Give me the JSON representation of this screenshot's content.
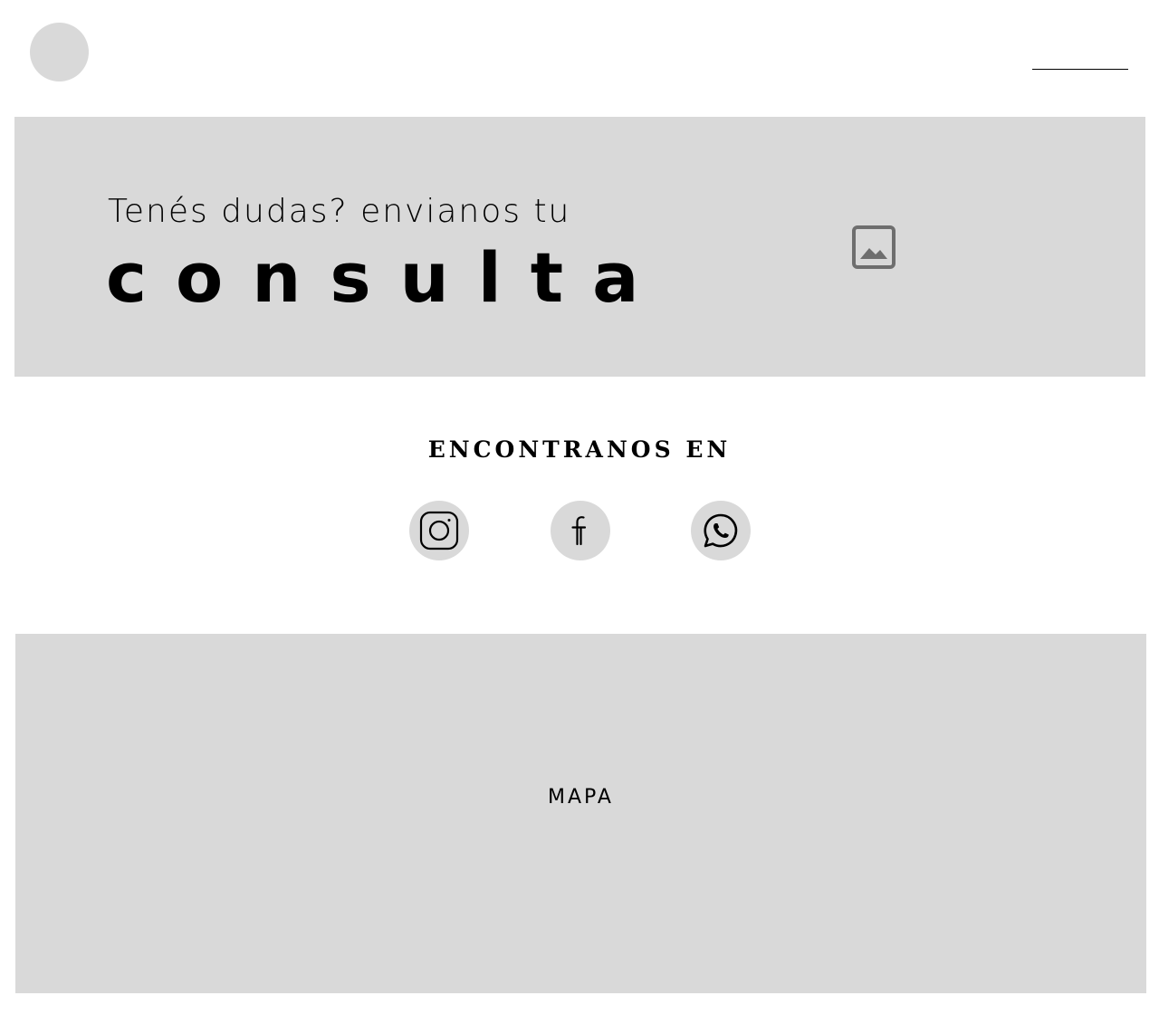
{
  "header": {
    "logo_icon": "logo-placeholder",
    "menu_icon": "menu-line-icon"
  },
  "hero": {
    "subtitle": "Tenés dudas? envianos tu",
    "title": "consulta",
    "image_icon": "image-placeholder-icon",
    "background_color": "#d9d9d9"
  },
  "find_us": {
    "title": "ENCONTRANOS EN",
    "socials": [
      {
        "icon": "instagram-icon"
      },
      {
        "icon": "facebook-icon"
      },
      {
        "icon": "whatsapp-icon"
      }
    ]
  },
  "map": {
    "label": "MAPA",
    "background_color": "#d9d9d9"
  }
}
